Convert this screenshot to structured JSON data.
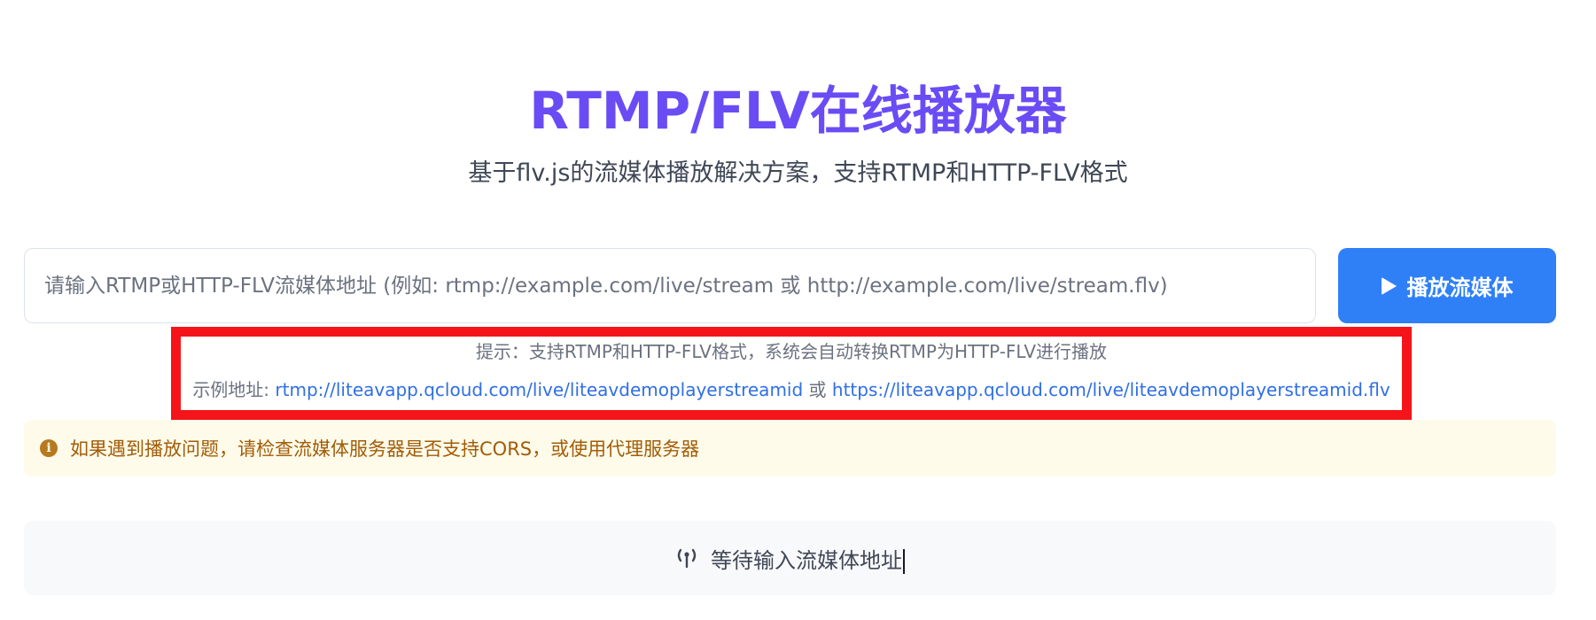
{
  "header": {
    "title": "RTMP/FLV在线播放器",
    "subtitle": "基于flv.js的流媒体播放解决方案，支持RTMP和HTTP-FLV格式"
  },
  "player_form": {
    "url_placeholder": "请输入RTMP或HTTP-FLV流媒体地址 (例如: rtmp://example.com/live/stream 或 http://example.com/live/stream.flv)",
    "url_value": "",
    "play_button_label": "播放流媒体",
    "play_icon": "play-icon"
  },
  "hint": {
    "text": "提示：支持RTMP和HTTP-FLV格式，系统会自动转换RTMP为HTTP-FLV进行播放",
    "example_prefix": "示例地址: ",
    "example_rtmp": "rtmp://liteavapp.qcloud.com/live/liteavdemoplayerstreamid",
    "example_separator": " 或 ",
    "example_flv": "https://liteavapp.qcloud.com/live/liteavdemoplayerstreamid.flv"
  },
  "warning": {
    "icon": "info-icon",
    "text": "如果遇到播放问题，请检查流媒体服务器是否支持CORS，或使用代理服务器"
  },
  "status": {
    "icon": "broadcast-tower-icon",
    "text": "等待输入流媒体地址"
  },
  "colors": {
    "title": "#6a4cf5",
    "primary_button": "#2f80f7",
    "highlight_border": "#f5141a",
    "link": "#2f6fe4",
    "warning_bg": "#fefbea",
    "warning_text": "#a15c07"
  }
}
